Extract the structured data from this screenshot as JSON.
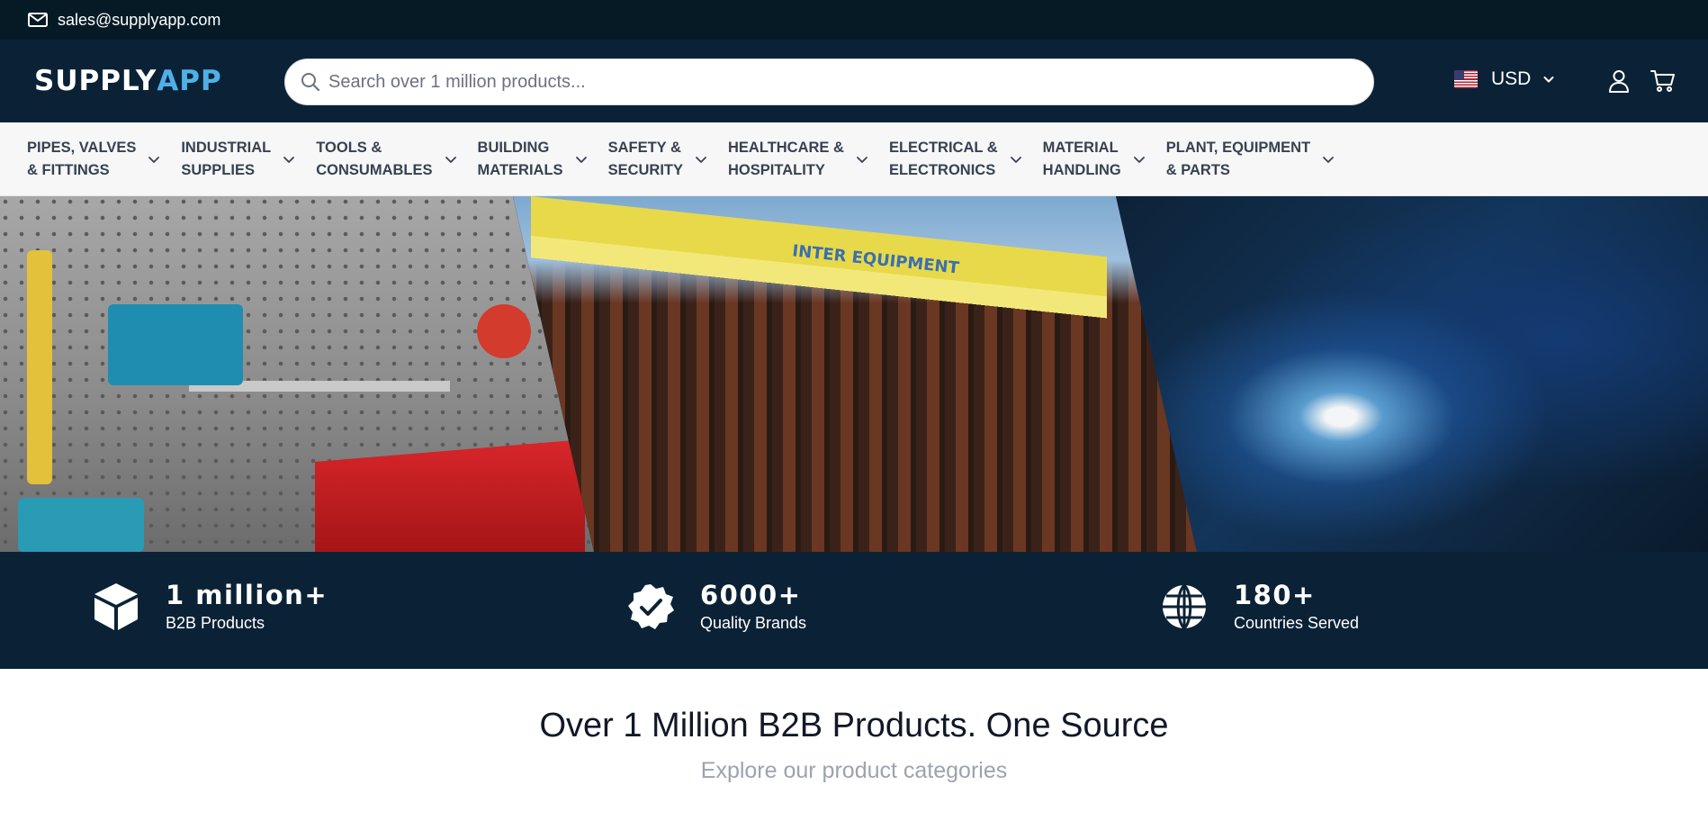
{
  "topbar": {
    "email": "sales@supplyapp.com",
    "mail_icon": "mail-icon"
  },
  "header": {
    "logo_main": "SUPPLY",
    "logo_accent": "APP",
    "search_placeholder": "Search over 1 million products...",
    "currency": "USD",
    "icons": [
      "search-icon",
      "us-flag-icon",
      "chevron-down-icon",
      "user-icon",
      "cart-icon"
    ]
  },
  "nav": {
    "items": [
      {
        "line1": "PIPES, VALVES",
        "line2": "& FITTINGS"
      },
      {
        "line1": "INDUSTRIAL",
        "line2": "SUPPLIES"
      },
      {
        "line1": "TOOLS &",
        "line2": "CONSUMABLES"
      },
      {
        "line1": "BUILDING",
        "line2": "MATERIALS"
      },
      {
        "line1": "SAFETY &",
        "line2": "SECURITY"
      },
      {
        "line1": "HEALTHCARE &",
        "line2": "HOSPITALITY"
      },
      {
        "line1": "ELECTRICAL &",
        "line2": "ELECTRONICS"
      },
      {
        "line1": "MATERIAL",
        "line2": "HANDLING"
      },
      {
        "line1": "PLANT, EQUIPMENT",
        "line2": "& PARTS"
      }
    ]
  },
  "hero": {
    "crane_text": "INTER EQUIPMENT"
  },
  "stats": [
    {
      "value": "1 million+",
      "label": "B2B Products",
      "icon": "cube-icon"
    },
    {
      "value": "6000+",
      "label": "Quality Brands",
      "icon": "verified-badge-icon"
    },
    {
      "value": "180+",
      "label": "Countries Served",
      "icon": "globe-icon"
    }
  ],
  "intro": {
    "title": "Over 1 Million B2B Products. One Source",
    "subtitle": "Explore our product categories"
  },
  "colors": {
    "topbar_bg": "#061a26",
    "header_bg": "#0b2236",
    "logo_accent": "#4fb0e8",
    "nav_bg": "#f7f7f7"
  }
}
